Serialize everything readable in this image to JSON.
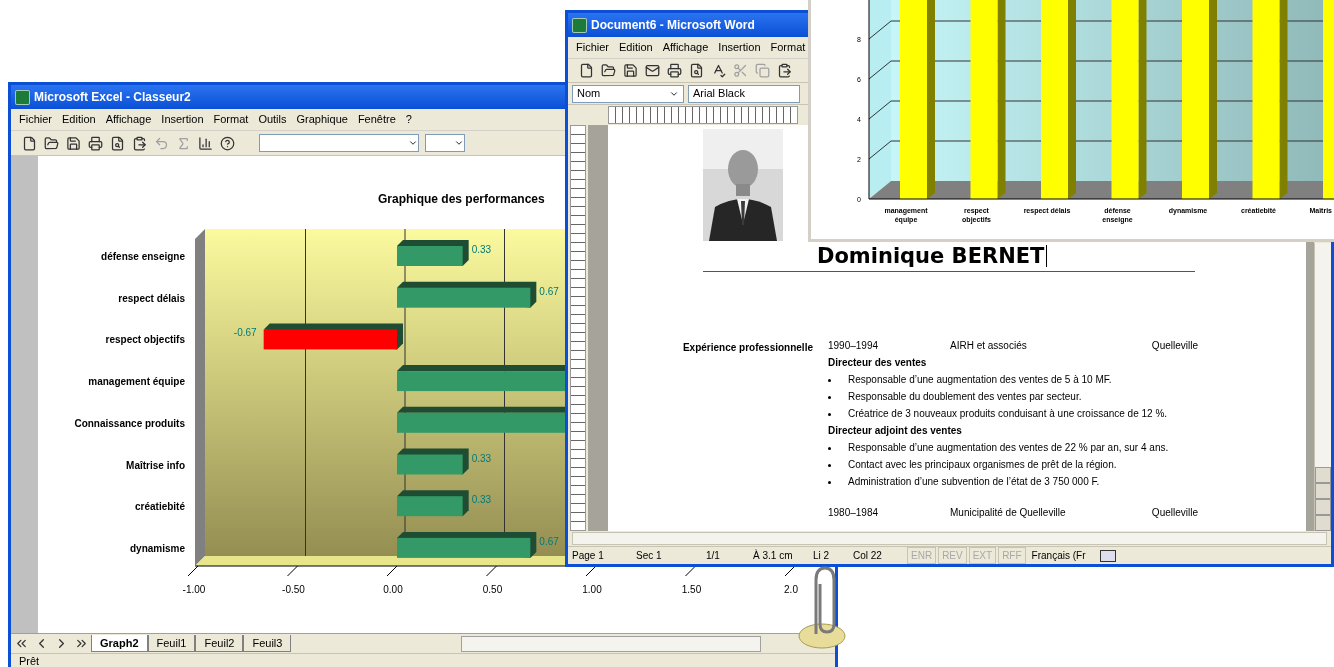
{
  "excel": {
    "title": "Microsoft Excel - Classeur2",
    "menu": [
      "Fichier",
      "Edition",
      "Affichage",
      "Insertion",
      "Format",
      "Outils",
      "Graphique",
      "Fenêtre",
      "?"
    ],
    "chart": {
      "chart_data": {
        "type": "bar",
        "orientation": "horizontal",
        "title": "Graphique des performances",
        "stacked": true,
        "categories": [
          "défense enseigne",
          "respect délais",
          "respect objectifs",
          "management équipe",
          "Connaissance produits",
          "Maîtrise info",
          "créatiebité",
          "dynamisme"
        ],
        "series": [
          {
            "color": "#339966",
            "values": [
              0.33,
              0.67,
              null,
              null,
              null,
              0.33,
              0.33,
              0.67
            ]
          },
          {
            "color": "#ff0000",
            "values": [
              null,
              null,
              -0.67,
              null,
              null,
              null,
              null,
              null
            ]
          }
        ],
        "xlim": [
          -1,
          2
        ],
        "xticks": [
          {
            "value": -1,
            "label": "-1.00"
          },
          {
            "value": -0.5,
            "label": "-0.50"
          },
          {
            "value": 0,
            "label": "0.00"
          },
          {
            "value": 0.5,
            "label": "0.50"
          },
          {
            "value": 1,
            "label": "1.00"
          },
          {
            "value": 1.5,
            "label": "1.50"
          },
          {
            "value": 2,
            "label": "2.0"
          }
        ],
        "data_labels": true
      }
    },
    "sheet_tabs": [
      {
        "label": "Graph2",
        "selected": true
      },
      {
        "label": "Feuil1",
        "selected": false
      },
      {
        "label": "Feuil2",
        "selected": false
      },
      {
        "label": "Feuil3",
        "selected": false
      }
    ],
    "status": "Prêt"
  },
  "word": {
    "title": "Document6 - Microsoft Word",
    "menu": [
      "Fichier",
      "Edition",
      "Affichage",
      "Insertion",
      "Format"
    ],
    "style_box": {
      "value": "Nom"
    },
    "font_box": {
      "value": "Arial Black"
    },
    "document": {
      "name": "Dominique BERNET",
      "section": "Expérience professionnelle",
      "jobs": [
        {
          "period": "1990–1994",
          "employer": "AIRH et associés",
          "city": "Quelleville",
          "roles": [
            {
              "title": "Directeur des ventes",
              "bullets": [
                "Responsable d’une augmentation des ventes de 5 à 10 MF.",
                "Responsable du doublement des ventes par secteur.",
                "Créatrice de 3 nouveaux produits conduisant à une croissance de 12 %."
              ]
            },
            {
              "title": "Directeur adjoint des ventes",
              "bullets": [
                "Responsable d’une augmentation des ventes de 22 % par an, sur 4 ans.",
                "Contact avec les principaux organismes de prêt de la région.",
                "Administration d’une subvention de l’état de 3 750 000 F."
              ]
            }
          ]
        },
        {
          "period": "1980–1984",
          "employer": "Municipalité de Quelleville",
          "city": "Quelleville"
        }
      ]
    },
    "status_bar": {
      "page": "Page 1",
      "section": "Sec 1",
      "pages": "1/1",
      "position": "À 3.1 cm",
      "line": "Li 2",
      "column": "Col 22",
      "modes": [
        {
          "label": "ENR",
          "on": false
        },
        {
          "label": "REV",
          "on": false
        },
        {
          "label": "EXT",
          "on": false
        },
        {
          "label": "RFF",
          "on": false
        }
      ],
      "language": "Français (Fr"
    }
  },
  "chart_window": {
    "chart_data": {
      "type": "bar",
      "orientation": "vertical",
      "categories": [
        "management équipe",
        "respect objectifs",
        "respect délais",
        "défense enseigne",
        "dynamisme",
        "créatiebité",
        "Maîtris"
      ],
      "series": [
        {
          "color": "#ffff00",
          "values": [
            null,
            null,
            null,
            null,
            null,
            null,
            null
          ]
        }
      ],
      "ylim": [
        0,
        10
      ],
      "yticks": [
        0,
        2,
        4,
        6,
        8
      ]
    }
  }
}
